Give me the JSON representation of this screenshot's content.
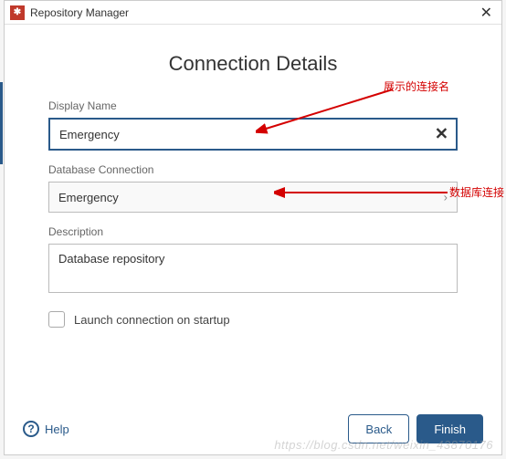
{
  "titlebar": {
    "title": "Repository Manager"
  },
  "main": {
    "heading": "Connection Details",
    "display_name_label": "Display Name",
    "display_name_value": "Emergency",
    "db_conn_label": "Database Connection",
    "db_conn_value": "Emergency",
    "description_label": "Description",
    "description_value": "Database repository",
    "checkbox_label": "Launch connection on startup"
  },
  "footer": {
    "help_label": "Help",
    "back_label": "Back",
    "finish_label": "Finish"
  },
  "annotations": {
    "a1": "展示的连接名",
    "a2": "数据库连接"
  },
  "watermark": "https://blog.csdn.net/weixin_43870176"
}
